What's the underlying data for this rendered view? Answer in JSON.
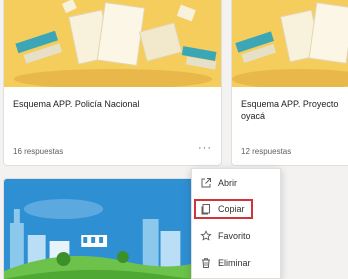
{
  "cards": [
    {
      "title": "Esquema APP. Policía Nacional",
      "responses": "16 respuestas",
      "more_label": "···"
    },
    {
      "title": "Esquema APP. Proyecto oyacá",
      "responses": "12 respuestas"
    }
  ],
  "context_menu": {
    "items": [
      {
        "label": "Abrir",
        "icon": "open-external-icon"
      },
      {
        "label": "Copiar",
        "icon": "copy-icon",
        "highlighted": true
      },
      {
        "label": "Favorito",
        "icon": "star-icon"
      },
      {
        "label": "Eliminar",
        "icon": "trash-icon"
      }
    ]
  },
  "colors": {
    "card_art_bg": "#f4cd5c",
    "city_sky": "#2f8fd3",
    "highlight_border": "#d13438"
  }
}
